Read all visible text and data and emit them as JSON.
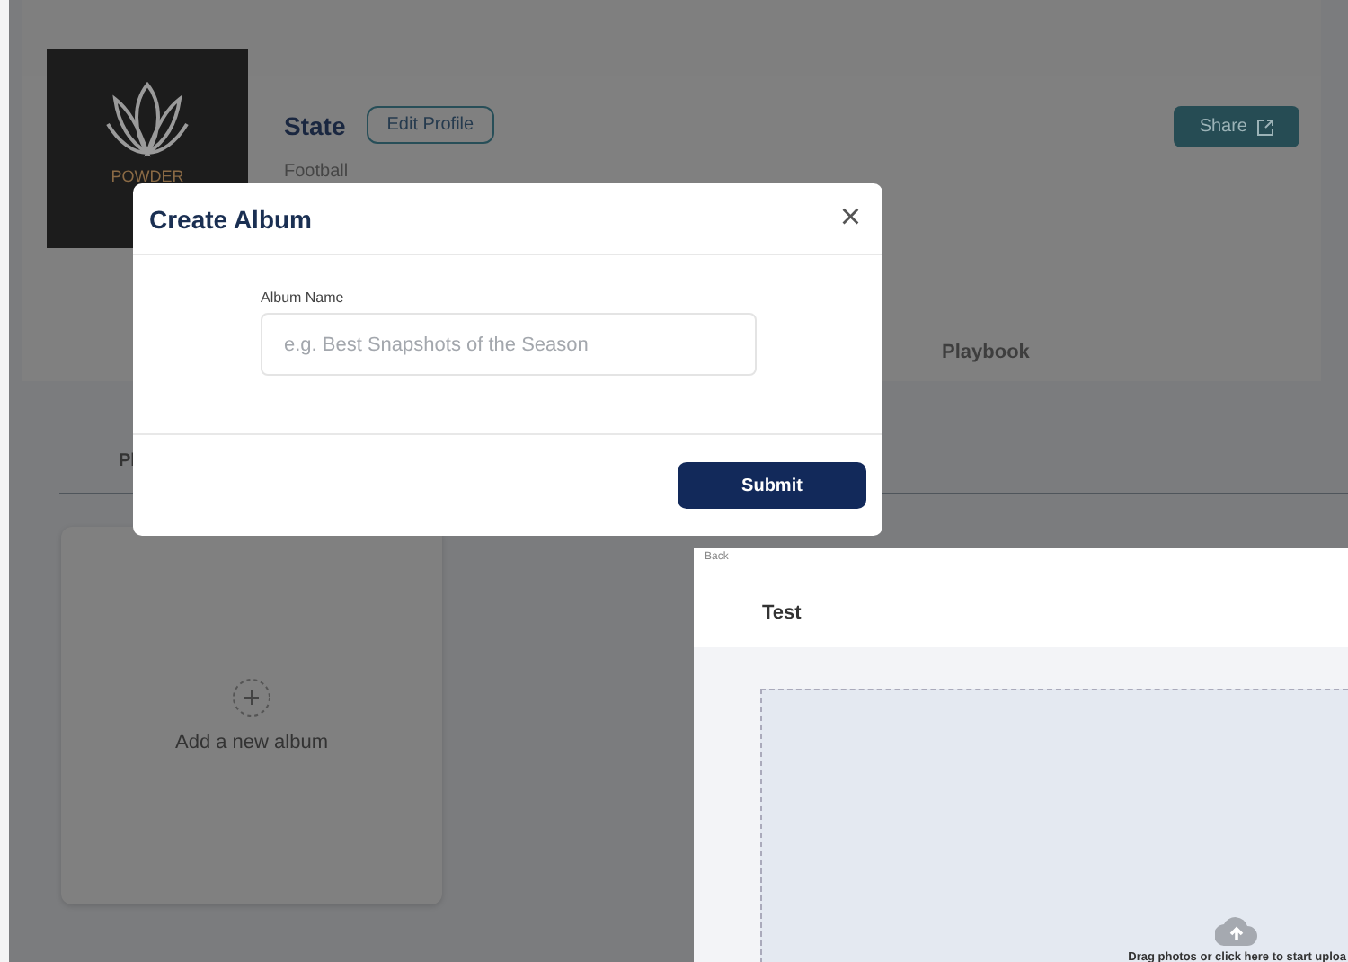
{
  "profile": {
    "logo_text": "POWDER",
    "team_name": "State",
    "edit_button": "Edit Profile",
    "sport": "Football",
    "share_button": "Share"
  },
  "header_tabs": [
    {
      "label": "Playbook"
    }
  ],
  "album_tabs": [
    {
      "label": "Pl"
    }
  ],
  "add_album_card": {
    "label": "Add a new album"
  },
  "modal": {
    "title": "Create Album",
    "close": "×",
    "field_label": "Album Name",
    "placeholder": "e.g. Best Snapshots of the Season",
    "submit": "Submit"
  },
  "upload_window": {
    "back": "Back",
    "title": "Test",
    "dropzone_text": "Drag photos or click here to start uploa"
  }
}
